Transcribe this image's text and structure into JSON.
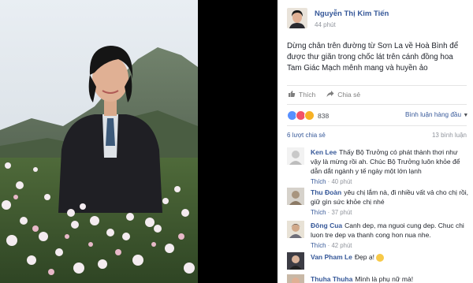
{
  "post": {
    "author": "Nguyễn Thị Kim Tiến",
    "time": "44 phút",
    "text": "Dừng chân trên đường từ Sơn La về Hoà Bình để được thư giãn trong chốc lát trên cánh đồng hoa Tam Giác Mạch mênh mang và huyền ảo"
  },
  "actions": {
    "like": "Thích",
    "share": "Chia sẻ"
  },
  "reactions": {
    "count": "838",
    "sort_label": "Bình luận hàng đầu"
  },
  "shares": "6 lượt chia sẻ",
  "comments_count": "13 bình luận",
  "comments": [
    {
      "author": "Ken Lee",
      "text": "Thấy Bộ Trưởng có phát thành thơi như vậy là mừng rồi ah. Chúc Bộ Trưởng luôn khỏe để dẫn dắt ngành y tế ngày một lớn lạnh",
      "like": "Thích",
      "time": "40 phút"
    },
    {
      "author": "Thu Đoàn",
      "text": "yêu chị lắm nà, đi nhiều vất vả cho chị rồi, giữ gìn sức khỏe chị nhé",
      "like": "Thích",
      "time": "37 phút"
    },
    {
      "author": "Đông Cua",
      "text": "Canh dep, ma nguoi cung dep. Chuc chi luon tre dep va thanh cong hon nua nhe.",
      "like": "Thích",
      "time": "42 phút"
    },
    {
      "author": "Van Pham Le",
      "text": "Đẹp ạ!",
      "like": "",
      "time": ""
    },
    {
      "author": "Thuha Thuha",
      "text": "Mình là phụ nữ mà!",
      "like": "",
      "time": ""
    }
  ],
  "colors": {
    "link": "#365899",
    "muted": "#90949c",
    "text": "#1d2129",
    "like_blue": "#5890ff",
    "love_red": "#f25268"
  },
  "icons": [
    "thumbs-up-icon",
    "share-icon",
    "chevron-down-icon"
  ]
}
